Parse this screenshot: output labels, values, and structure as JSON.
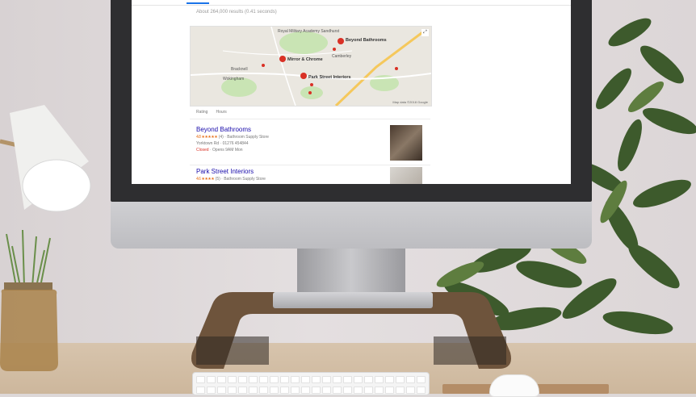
{
  "screen": {
    "result_stats": "About 264,000 results (0.41 seconds)",
    "map": {
      "labels": [
        {
          "text": "Royal Military Academy Sandhurst",
          "cls": ""
        },
        {
          "text": "Beyond Bathrooms",
          "cls": "bold"
        },
        {
          "text": "Camberley",
          "cls": ""
        },
        {
          "text": "Bracknell",
          "cls": ""
        },
        {
          "text": "Mirror & Chrome",
          "cls": "bold"
        },
        {
          "text": "Park Street Interiors",
          "cls": "bold"
        },
        {
          "text": "Wokingham",
          "cls": ""
        }
      ],
      "attribution": "Map data ©2018 Google",
      "expand_icon": "expand-icon"
    },
    "filters": [
      "Rating",
      "Hours"
    ],
    "listings": [
      {
        "name": "Beyond Bathrooms",
        "stars": "4.8 ★★★★★",
        "category": "(4) · Bathroom Supply Store",
        "address": "Yorktown Rd · 01276 454844",
        "status": "Closed",
        "hours": "· Opens 9AM Mon"
      },
      {
        "name": "Park Street Interiors",
        "stars": "4.6 ★★★★",
        "category": "(5) · Bathroom Supply Store"
      }
    ]
  },
  "colors": {
    "link": "#1a0dab",
    "star": "#e7711b",
    "closed": "#d93025",
    "pin": "#d93025"
  }
}
